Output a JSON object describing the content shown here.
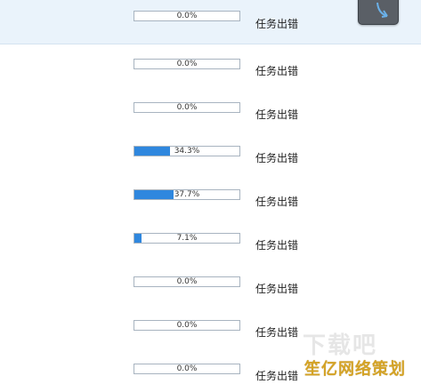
{
  "tasks": [
    {
      "percent_label": "0.0%",
      "progress": 0.0,
      "status": "任务出错"
    },
    {
      "percent_label": "0.0%",
      "progress": 0.0,
      "status": "任务出错"
    },
    {
      "percent_label": "0.0%",
      "progress": 0.0,
      "status": "任务出错"
    },
    {
      "percent_label": "34.3%",
      "progress": 0.343,
      "status": "任务出错"
    },
    {
      "percent_label": "37.7%",
      "progress": 0.377,
      "status": "任务出错"
    },
    {
      "percent_label": "7.1%",
      "progress": 0.071,
      "status": "任务出错"
    },
    {
      "percent_label": "0.0%",
      "progress": 0.0,
      "status": "任务出错"
    },
    {
      "percent_label": "0.0%",
      "progress": 0.0,
      "status": "任务出错"
    },
    {
      "percent_label": "0.0%",
      "progress": 0.0,
      "status": "任务出错"
    }
  ],
  "watermark": {
    "top": "下载吧",
    "bottom": "笙亿网络策划"
  },
  "colors": {
    "progress_fill": "#2f87de",
    "selected_row": "#eaf3fb",
    "watermark_text": "#d4a326"
  },
  "icons": {
    "dark_button": "refresh-icon"
  }
}
